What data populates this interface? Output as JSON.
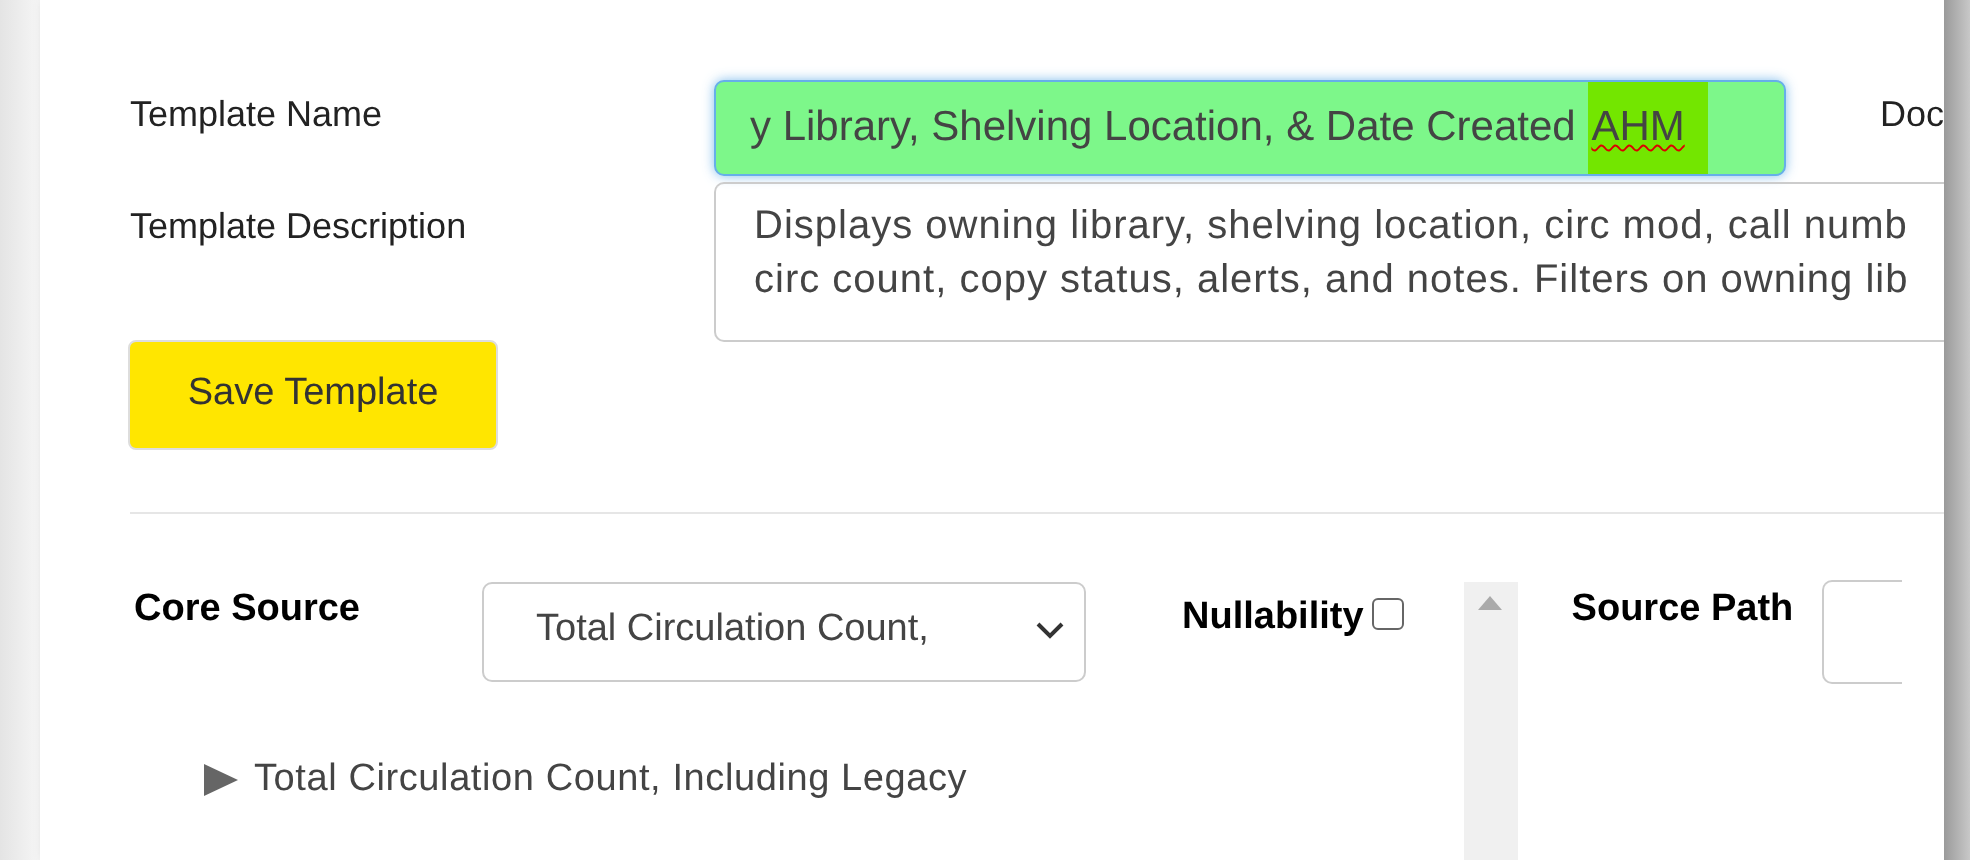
{
  "template_name": {
    "label": "Template Name",
    "value": "y Library, Shelving Location, & Date Created",
    "highlighted_value": "AHM",
    "focused": true
  },
  "doc_label": "Doc",
  "template_description": {
    "label": "Template Description",
    "lines": [
      "Displays owning library, shelving location, circ mod, call numb",
      "circ count, copy status, alerts, and notes. Filters on owning lib"
    ]
  },
  "save_button": "Save Template",
  "core_source": {
    "label": "Core Source",
    "selected_option": "Total Circulation Count,"
  },
  "nullability": {
    "label": "Nullability",
    "checked": false
  },
  "source_path": {
    "label": "Source Path"
  },
  "tree": [
    {
      "label": "Total Circulation Count, Including Legacy",
      "expanded": false
    }
  ]
}
